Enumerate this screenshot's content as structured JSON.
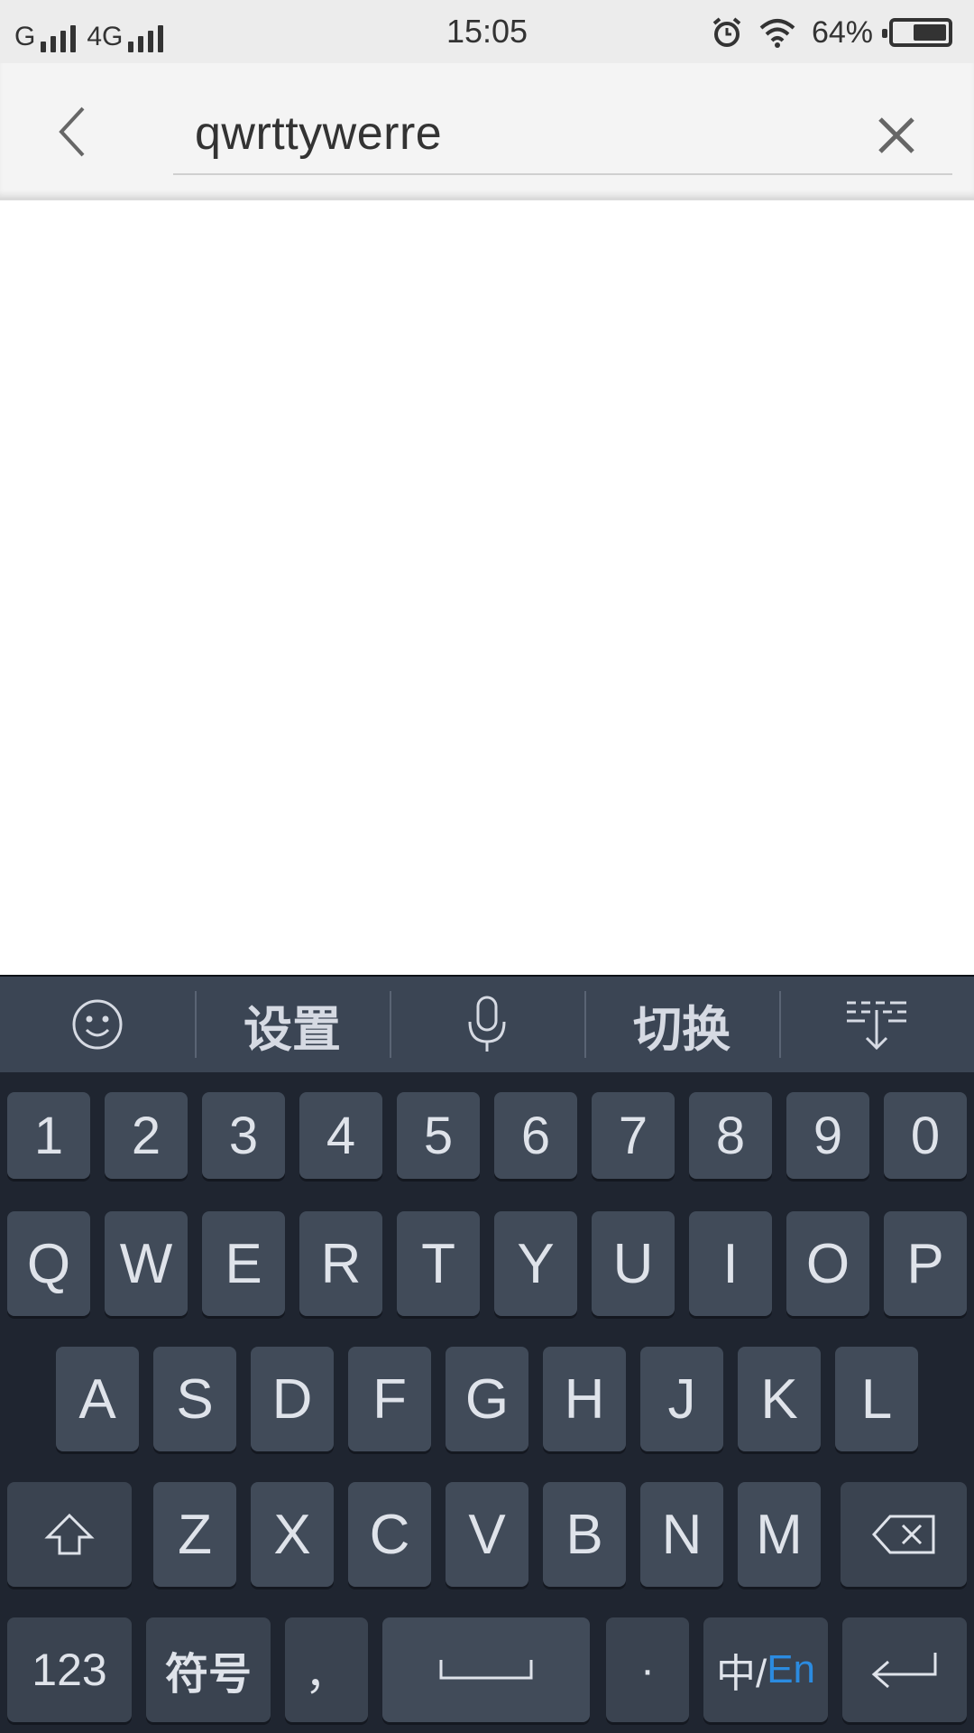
{
  "status_bar": {
    "carrier": "G",
    "network": "4G",
    "time": "15:05",
    "battery": "64%",
    "battery_level": 0.64,
    "icons": [
      "alarm-icon",
      "wifi-icon",
      "battery-icon",
      "signal-icon"
    ]
  },
  "search": {
    "query": "qwrttywerre",
    "back_icon": "chevron-left-icon",
    "clear_icon": "close-icon"
  },
  "keyboard": {
    "toolbar": {
      "emoji_icon": "smiley-icon",
      "settings_label": "设置",
      "mic_icon": "microphone-icon",
      "switch_label": "切换",
      "hide_icon": "keyboard-hide-icon"
    },
    "number_row": [
      "1",
      "2",
      "3",
      "4",
      "5",
      "6",
      "7",
      "8",
      "9",
      "0"
    ],
    "row1": [
      "Q",
      "W",
      "E",
      "R",
      "T",
      "Y",
      "U",
      "I",
      "O",
      "P"
    ],
    "row2": [
      "A",
      "S",
      "D",
      "F",
      "G",
      "H",
      "J",
      "K",
      "L"
    ],
    "row3": [
      "Z",
      "X",
      "C",
      "V",
      "B",
      "N",
      "M"
    ],
    "bottom": {
      "num_label": "123",
      "symbol_label": "符号",
      "comma_label": "，",
      "period_label": "·",
      "lang_zh": "中/",
      "lang_en": "En"
    },
    "colors": {
      "background": "#1f2530",
      "key": "#414b59",
      "toolbar": "#3b4554",
      "accent": "#2b8be0"
    }
  }
}
